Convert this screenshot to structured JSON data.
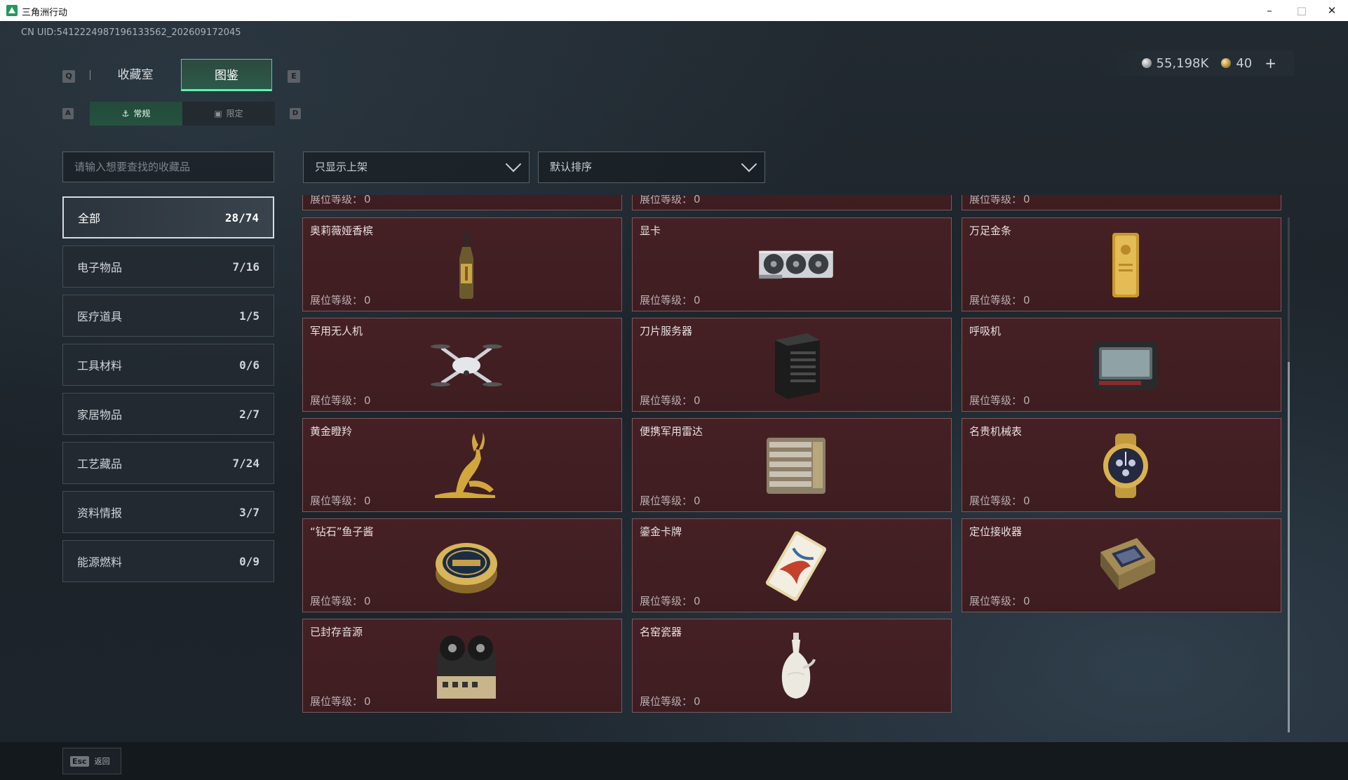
{
  "window": {
    "title": "三角洲行动",
    "minimize": "–",
    "maximize": "□",
    "close": "✕"
  },
  "uid": "CN UID:5412224987196133562_202609172045",
  "currency": {
    "silver": "55,198K",
    "gold": "40",
    "add": "+"
  },
  "hints": {
    "left": "Q",
    "right": "E",
    "sub_left": "A",
    "sub_right": "D"
  },
  "tabs": [
    {
      "label": "收藏室",
      "active": false
    },
    {
      "label": "图鉴",
      "active": true
    }
  ],
  "sub_tabs": [
    {
      "label": "常规",
      "active": true
    },
    {
      "label": "限定",
      "active": false
    }
  ],
  "search": {
    "placeholder": "请输入想要查找的收藏品",
    "value": ""
  },
  "filters": {
    "shelf": "只显示上架",
    "sort": "默认排序"
  },
  "categories": [
    {
      "label": "全部",
      "count": "28/74",
      "active": true
    },
    {
      "label": "电子物品",
      "count": "7/16"
    },
    {
      "label": "医疗道具",
      "count": "1/5"
    },
    {
      "label": "工具材料",
      "count": "0/6"
    },
    {
      "label": "家居物品",
      "count": "2/7"
    },
    {
      "label": "工艺藏品",
      "count": "7/24"
    },
    {
      "label": "资料情报",
      "count": "3/7"
    },
    {
      "label": "能源燃料",
      "count": "0/9"
    }
  ],
  "level_label": "展位等级：",
  "items": [
    {
      "name": "",
      "level": "0",
      "icon": "partial-item"
    },
    {
      "name": "",
      "level": "0",
      "icon": "partial-item"
    },
    {
      "name": "",
      "level": "0",
      "icon": "partial-item"
    },
    {
      "name": "奥莉薇娅香槟",
      "level": "0",
      "icon": "champagne-bottle-icon"
    },
    {
      "name": "显卡",
      "level": "0",
      "icon": "graphics-card-icon"
    },
    {
      "name": "万足金条",
      "level": "0",
      "icon": "gold-bar-icon"
    },
    {
      "name": "军用无人机",
      "level": "0",
      "icon": "drone-icon"
    },
    {
      "name": "刀片服务器",
      "level": "0",
      "icon": "server-icon"
    },
    {
      "name": "呼吸机",
      "level": "0",
      "icon": "ventilator-icon"
    },
    {
      "name": "黄金瞪羚",
      "level": "0",
      "icon": "gold-gazelle-icon"
    },
    {
      "name": "便携军用雷达",
      "level": "0",
      "icon": "radar-icon"
    },
    {
      "name": "名贵机械表",
      "level": "0",
      "icon": "watch-icon"
    },
    {
      "name": "“钻石”鱼子酱",
      "level": "0",
      "icon": "caviar-tin-icon"
    },
    {
      "name": "鎏金卡牌",
      "level": "0",
      "icon": "gilded-card-icon"
    },
    {
      "name": "定位接收器",
      "level": "0",
      "icon": "gps-receiver-icon"
    },
    {
      "name": "已封存音源",
      "level": "0",
      "icon": "tape-recorder-icon"
    },
    {
      "name": "名窑瓷器",
      "level": "0",
      "icon": "porcelain-vase-icon"
    }
  ],
  "bottom": {
    "key": "Esc",
    "label": "返回"
  },
  "colors": {
    "accent_green": "#4bd39a",
    "card_bg": "#452024",
    "card_border": "#7a5a60"
  }
}
